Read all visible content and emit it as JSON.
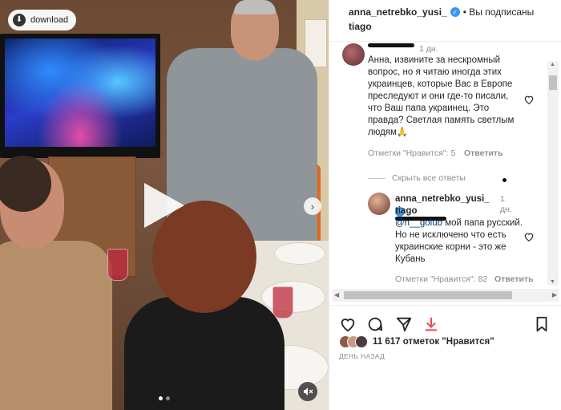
{
  "media": {
    "download_label": "download",
    "carousel": {
      "total": 2,
      "current": 1
    }
  },
  "header": {
    "username_line1": "anna_netrebko_yusi_",
    "username_line2": "tiago",
    "follow_status": "• Вы подписаны"
  },
  "comments": [
    {
      "time": "1 дн.",
      "text": "Анна, извините за нескромный вопрос, но я читаю иногда этих украинцев, которые Вас в Европе преследуют и они где-то писали, что Ваш папа украинец. Это правда? Светлая память светлым людям🙏",
      "likes": "Отметки \"Нравится\": 5",
      "reply_label": "Ответить"
    }
  ],
  "hide_replies_label": "Скрыть все ответы",
  "reply": {
    "username_line1": "anna_netrebko_yusi_",
    "username_line2": "tiago",
    "time_line1": "1",
    "time_line2": "дн.",
    "mention": "@n__golub",
    "text": " мой папа русский. Но не исключено что есть украинские корни - это же Кубань",
    "likes": "Отметки \"Нравится\": 82",
    "reply_label": "Ответить"
  },
  "likes": {
    "count_text": "11 617 отметок \"Нравится\""
  },
  "timestamp": "ДЕНЬ НАЗАД",
  "colors": {
    "accent": "#3897f0",
    "save_icon_red": "#ed4956",
    "text_secondary": "#8e8e8e"
  }
}
